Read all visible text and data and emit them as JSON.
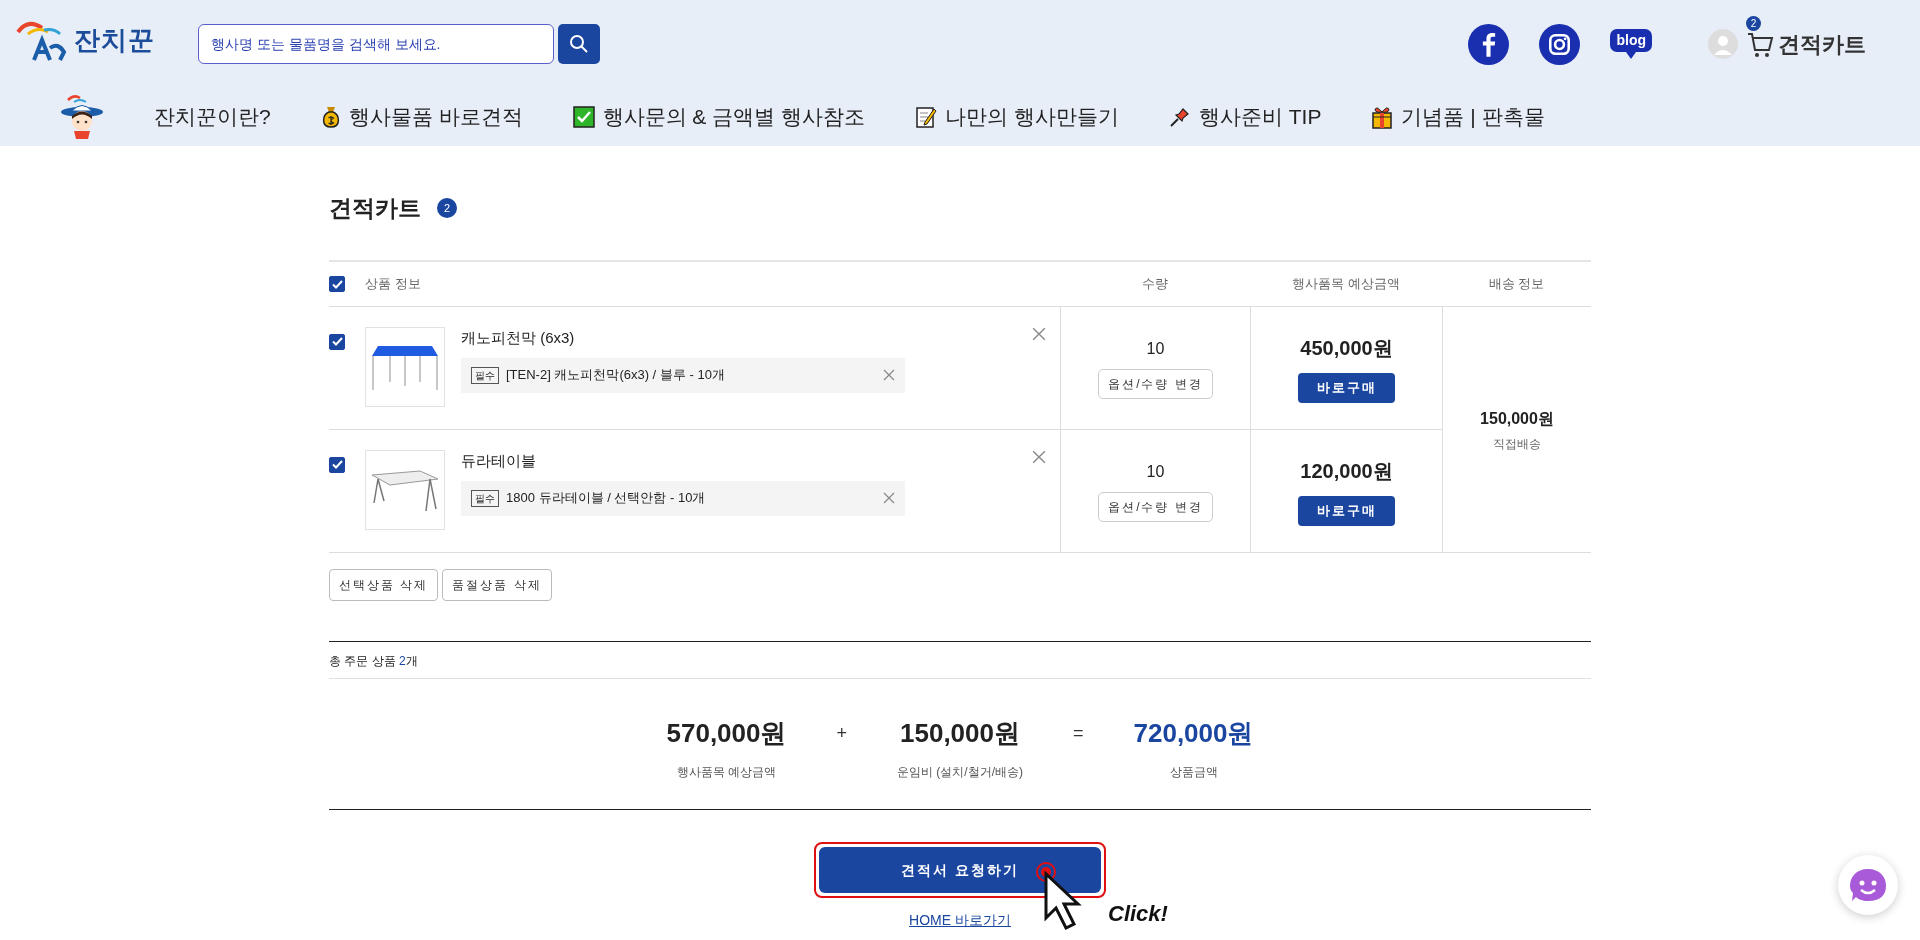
{
  "header": {
    "logo_text": "잔치꾼",
    "search": {
      "placeholder": "행사명 또는 물품명을 검색해 보세요."
    },
    "social": [
      {
        "kind": "facebook"
      },
      {
        "kind": "instagram"
      },
      {
        "kind": "blog",
        "label": "blog"
      }
    ],
    "cart_link": {
      "label": "견적카트",
      "count": "2"
    }
  },
  "nav": [
    {
      "kind": "mascot",
      "label": "잔치꾼이란?"
    },
    {
      "kind": "money-bag",
      "label": "행사물품 바로견적"
    },
    {
      "kind": "check",
      "label": "행사문의 & 금액별 행사참조"
    },
    {
      "kind": "memo",
      "label": "나만의 행사만들기"
    },
    {
      "kind": "pin",
      "label": "행사준비 TIP"
    },
    {
      "kind": "gift",
      "label": "기념품 | 판촉물"
    }
  ],
  "cart": {
    "title": "견적카트",
    "count": "2",
    "select_all": {
      "checked": true
    },
    "columns": [
      "상품 정보",
      "수량",
      "행사품목 예상금액",
      "배송 정보"
    ],
    "items": [
      {
        "checked": true,
        "kind": "canopy",
        "name": "캐노피천막 (6x3)",
        "option_tag": "필수",
        "option": "[TEN-2] 캐노피천막(6x3) / 블루 - 10개",
        "quantity": "10",
        "change_button": "옵션/수량 변경",
        "price": "450,000원",
        "buy_button": "바로구매"
      },
      {
        "checked": true,
        "kind": "table",
        "name": "듀라테이블",
        "option_tag": "필수",
        "option": "1800 듀라테이블 / 선택안함 - 10개",
        "quantity": "10",
        "change_button": "옵션/수량 변경",
        "price": "120,000원",
        "buy_button": "바로구매"
      }
    ],
    "shipping": {
      "price": "150,000원",
      "method": "직접배송"
    },
    "actions": [
      "선택상품 삭제",
      "품절상품 삭제"
    ]
  },
  "summary": {
    "count_label": "총 주문 상품",
    "count": "2",
    "count_unit": "개",
    "totals": [
      {
        "amount": "570,000원",
        "label": "행사품목 예상금액",
        "highlight": false
      },
      {
        "amount": "150,000원",
        "label": "운임비 (설치/철거/배송)",
        "highlight": false
      },
      {
        "amount": "720,000원",
        "label": "상품금액",
        "highlight": true
      }
    ],
    "operators": [
      "+",
      "="
    ]
  },
  "request_button": "견적서 요청하기",
  "home_link": "HOME 바로가기",
  "click_annotation": "Click!"
}
